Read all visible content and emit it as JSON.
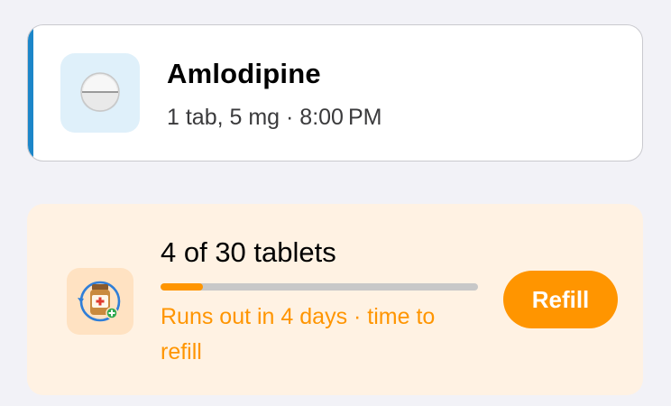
{
  "medication": {
    "name": "Amlodipine",
    "dose_line": "1 tab, 5 mg · 8:00 PM",
    "icon": "pill-icon",
    "accent_color": "#1c86c9"
  },
  "refill": {
    "count_text": "4 of 30 tablets",
    "remaining": 4,
    "total": 30,
    "status_text": "Runs out in 4 days · time to refill",
    "button_label": "Refill",
    "icon": "pill-bottle-refill-icon",
    "accent_color": "#ff9500"
  }
}
